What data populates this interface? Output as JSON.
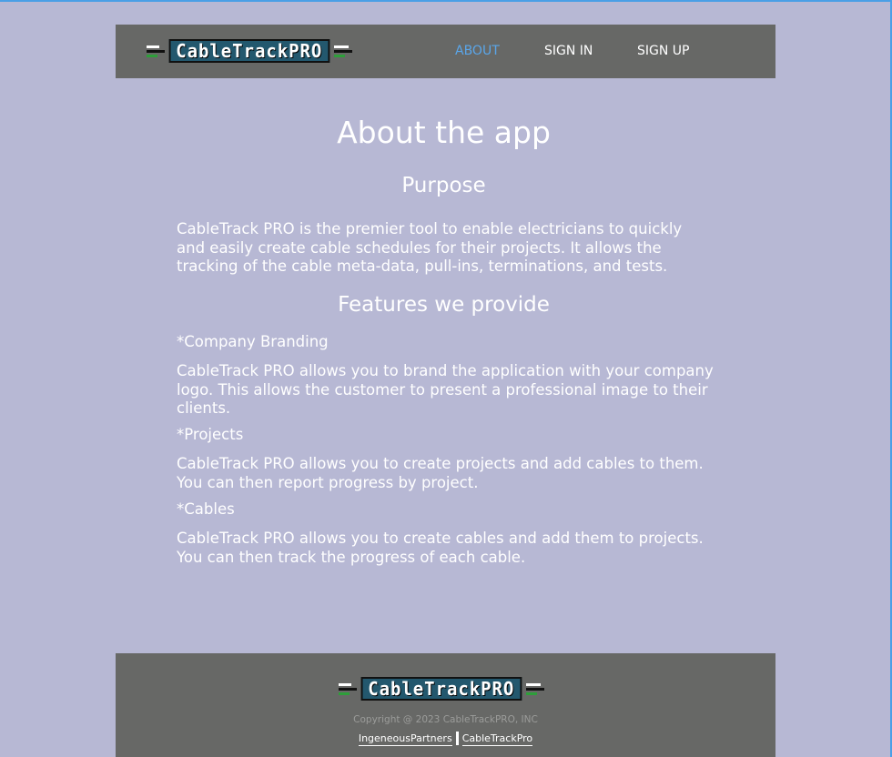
{
  "brand": {
    "logo_text": "CableTrackPRO"
  },
  "nav": {
    "about": "ABOUT",
    "sign_in": "SIGN IN",
    "sign_up": "SIGN UP"
  },
  "colors": {
    "background": "#b7b8d4",
    "header": "#676866",
    "nav_active": "#5aa6ea",
    "logo_bg": "#23586e"
  },
  "main": {
    "title": "About the app",
    "purpose_heading": "Purpose",
    "purpose_text": "CableTrack PRO is the premier tool to enable electricians to quickly and easily create cable schedules for their projects. It allows the tracking of the cable meta-data, pull-ins, terminations, and tests.",
    "features_heading": "Features we provide",
    "features": [
      {
        "title": "*Company Branding",
        "text": "CableTrack PRO allows you to brand the application with your company logo. This allows the customer to present a professional image to their clients."
      },
      {
        "title": "*Projects",
        "text": "CableTrack PRO allows you to create projects and add cables to them. You can then report progress by project."
      },
      {
        "title": "*Cables",
        "text": "CableTrack PRO allows you to create cables and add them to projects. You can then track the progress of each cable."
      }
    ]
  },
  "footer": {
    "copyright": "Copyright @ 2023 CableTrackPRO, INC",
    "link1": "IngeneousPartners",
    "link2": "CableTrackPro"
  }
}
